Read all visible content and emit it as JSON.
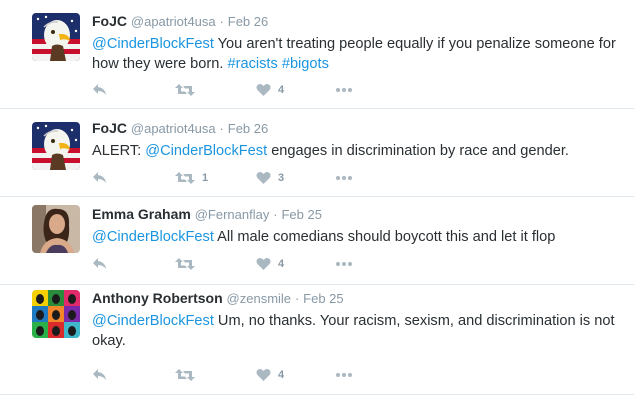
{
  "tweets": [
    {
      "fullname": "FoJC",
      "username": "@apatriot4usa",
      "sep": "·",
      "time": "Feb 26",
      "mention": "@CinderBlockFest",
      "text": " You aren't treating people equally if you penalize someone for how they were born. ",
      "hashtag1": "#racists",
      "hashtag2": "#bigots",
      "retweets": "",
      "likes": "4",
      "avatar": "eagle-avatar"
    },
    {
      "fullname": "FoJC",
      "username": "@apatriot4usa",
      "sep": "·",
      "time": "Feb 26",
      "prefix": "ALERT: ",
      "mention": "@CinderBlockFest",
      "text": " engages in discrimination by race and gender.",
      "retweets": "1",
      "likes": "3",
      "avatar": "eagle-avatar"
    },
    {
      "fullname": "Emma Graham",
      "username": "@Fernanflay",
      "sep": "·",
      "time": "Feb 25",
      "mention": "@CinderBlockFest",
      "text": " All male comedians should boycott this and let it flop",
      "retweets": "",
      "likes": "4",
      "avatar": "woman-avatar"
    },
    {
      "fullname": "Anthony Robertson",
      "username": "@zensmile",
      "sep": "·",
      "time": "Feb 25",
      "mention": "@CinderBlockFest",
      "text": " Um, no thanks. Your racism, sexism, and discrimination is not okay.",
      "retweets": "",
      "likes": "4",
      "avatar": "popart-avatar"
    }
  ],
  "colors": {
    "link": "#1b95e0",
    "muted": "#8899a6",
    "icon": "#aab8c2",
    "text": "#292f33",
    "divider": "#e1e8ed"
  },
  "icons": [
    "reply-icon",
    "retweet-icon",
    "heart-icon",
    "more-icon"
  ]
}
